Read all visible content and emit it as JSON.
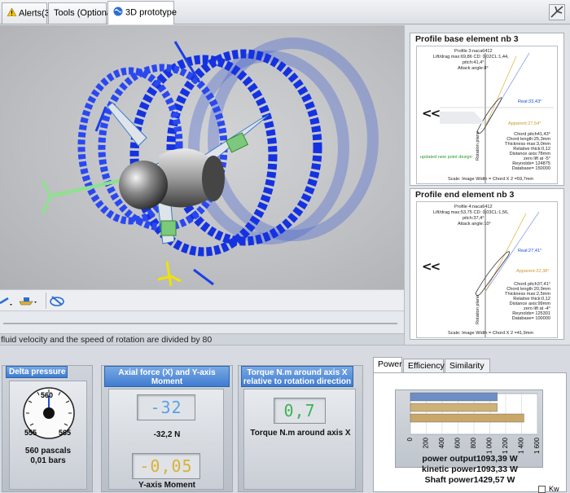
{
  "tabs": [
    {
      "label": "Alerts(3)",
      "icon": "warning-icon"
    },
    {
      "label": "Tools (Optional)",
      "icon": ""
    },
    {
      "label": "3D prototype",
      "icon": "globe-icon"
    }
  ],
  "viewport": {
    "status_text": "fluid velocity and the speed of rotation are divided by 80"
  },
  "profile_base": {
    "title": "Profile base element nb 3",
    "header_lines": [
      "Profile 3:naca6412",
      "Lift/drag max:69,86 CD: 0,02CL:1,44,",
      "pitch:41,4°",
      "Attack angle:8°"
    ],
    "real_label": "Real:33,43°",
    "apparent_label": "Apparent:27,54°",
    "nav": "<<",
    "info_lines": [
      "Chord pitch41,43°",
      "Chord length:25,3mm",
      "Thickness max:3,0mm",
      "Relative thick:0,12",
      "Distance axis:78mm",
      "zero lift at -5°",
      "Reynolds= 124875",
      "Database= 150000"
    ],
    "updated_note": "updated new point design",
    "rotation_label": "Rotation plane",
    "scale_line": "Scale: Image Width = Chord X 2 =59,7mm"
  },
  "profile_end": {
    "title": "Profile end element nb 3",
    "header_lines": [
      "Profile 4:naca6412",
      "Lift/drag max:53,75 CD: 0,03CL:1,56,",
      "pitch:37,4°",
      "Attack angle:10°"
    ],
    "real_label": "Real:27,41°",
    "apparent_label": "Apparent:22,38°",
    "nav": "<<",
    "info_lines": [
      "Chord pitch37,41°",
      "Chord length:20,9mm",
      "Thickness max:2,5mm",
      "Relative thick:0,12",
      "Distance axis:99mm",
      "zero lift at -4°",
      "Reynolds= 125301",
      "Database= 100000"
    ],
    "rotation_label": "Rotation plane",
    "scale_line": "Scale: Image Width = Chord X 2 =41,9mm"
  },
  "delta_pressure": {
    "title": "Delta pressure",
    "gauge_ticks": [
      "560",
      "555",
      "565"
    ],
    "line1": "560 pascals",
    "line2": "0,01 bars"
  },
  "axial_force": {
    "title": "Axial force (X) and Y-axis Moment",
    "lcd_force": "-32",
    "force_text": "-32,2 N",
    "lcd_moment": "-0,05",
    "moment_caption": "Y-axis Moment"
  },
  "torque": {
    "title": "Torque N.m around axis X relative to rotation direction",
    "lcd": "0,7",
    "caption": "Torque N.m around axis X"
  },
  "power_tabs": [
    "Power",
    "Efficiency",
    "Similarity"
  ],
  "chart_data": {
    "type": "bar",
    "orientation": "horizontal",
    "categories": [
      "power output",
      "kinetic power",
      "Shaft power"
    ],
    "values": [
      1093.39,
      1093.33,
      1429.57
    ],
    "colors": [
      "#6f8ec6",
      "#cdb278",
      "#c9a66a"
    ],
    "xlim": [
      0,
      1600
    ],
    "x_ticks": [
      "0",
      "200",
      "400",
      "600",
      "800",
      "1 000",
      "1 200",
      "1 400",
      "1 600"
    ]
  },
  "power_lines": [
    "power output1093,39 W",
    "kinetic power1093,33 W",
    "Shaft power1429,57 W"
  ],
  "kw_label": "Kw"
}
